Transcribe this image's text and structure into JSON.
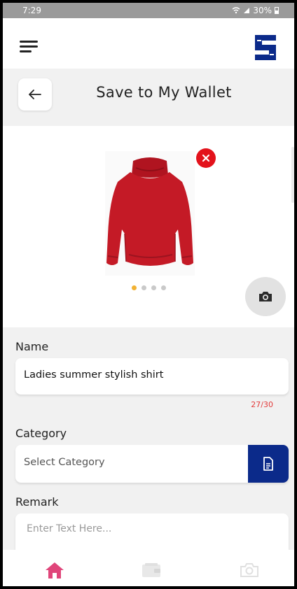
{
  "status_bar": {
    "time": "7:29",
    "battery": "30%"
  },
  "header": {
    "title": "Save to My Wallet"
  },
  "carousel": {
    "total_images": 4,
    "active_index": 0
  },
  "form": {
    "name_label": "Name",
    "name_value": "Ladies summer stylish shirt",
    "name_counter": "27/30",
    "category_label": "Category",
    "category_placeholder": "Select Category",
    "remark_label": "Remark",
    "remark_placeholder": "Enter Text Here..."
  },
  "colors": {
    "brand": "#0b2a8a",
    "accent_home": "#e0457a",
    "remove": "#e3121b",
    "active_dot": "#f2b233",
    "counter": "#e23a3a"
  },
  "bottom_nav": {
    "items": [
      "home-icon",
      "wallet-icon",
      "camera-icon"
    ],
    "active": "home-icon"
  }
}
